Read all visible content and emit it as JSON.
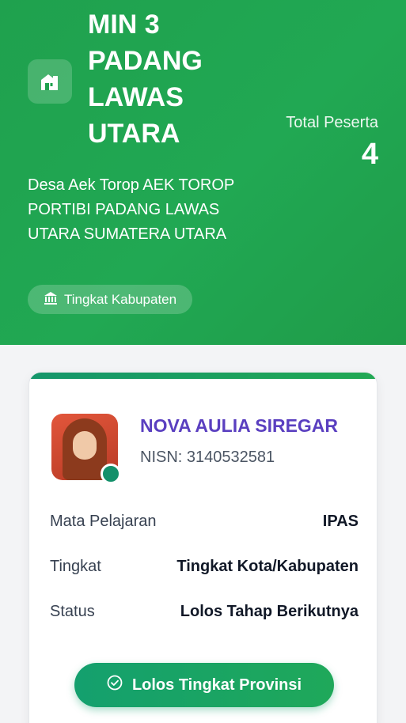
{
  "school": {
    "name": "MIN 3 PADANG LAWAS UTARA",
    "address": "Desa Aek Torop AEK TOROP PORTIBI PADANG LAWAS UTARA SUMATERA UTARA",
    "level_label": "Tingkat Kabupaten",
    "total_label": "Total Peserta",
    "total_count": "4"
  },
  "participant": {
    "name": "NOVA AULIA SIREGAR",
    "nisn": "NISN: 3140532581",
    "rows": [
      {
        "label": "Mata Pelajaran",
        "value": "IPAS"
      },
      {
        "label": "Tingkat",
        "value": "Tingkat Kota/Kabupaten"
      },
      {
        "label": "Status",
        "value": "Lolos Tahap Berikutnya"
      }
    ],
    "result_button": "Lolos Tingkat Provinsi"
  },
  "icons": [
    "school-icon",
    "building-icon",
    "check-circle-icon"
  ],
  "colors": {
    "header_green": "#21a853",
    "name_purple": "#5a3fc0",
    "button_green": "#14a06e"
  }
}
